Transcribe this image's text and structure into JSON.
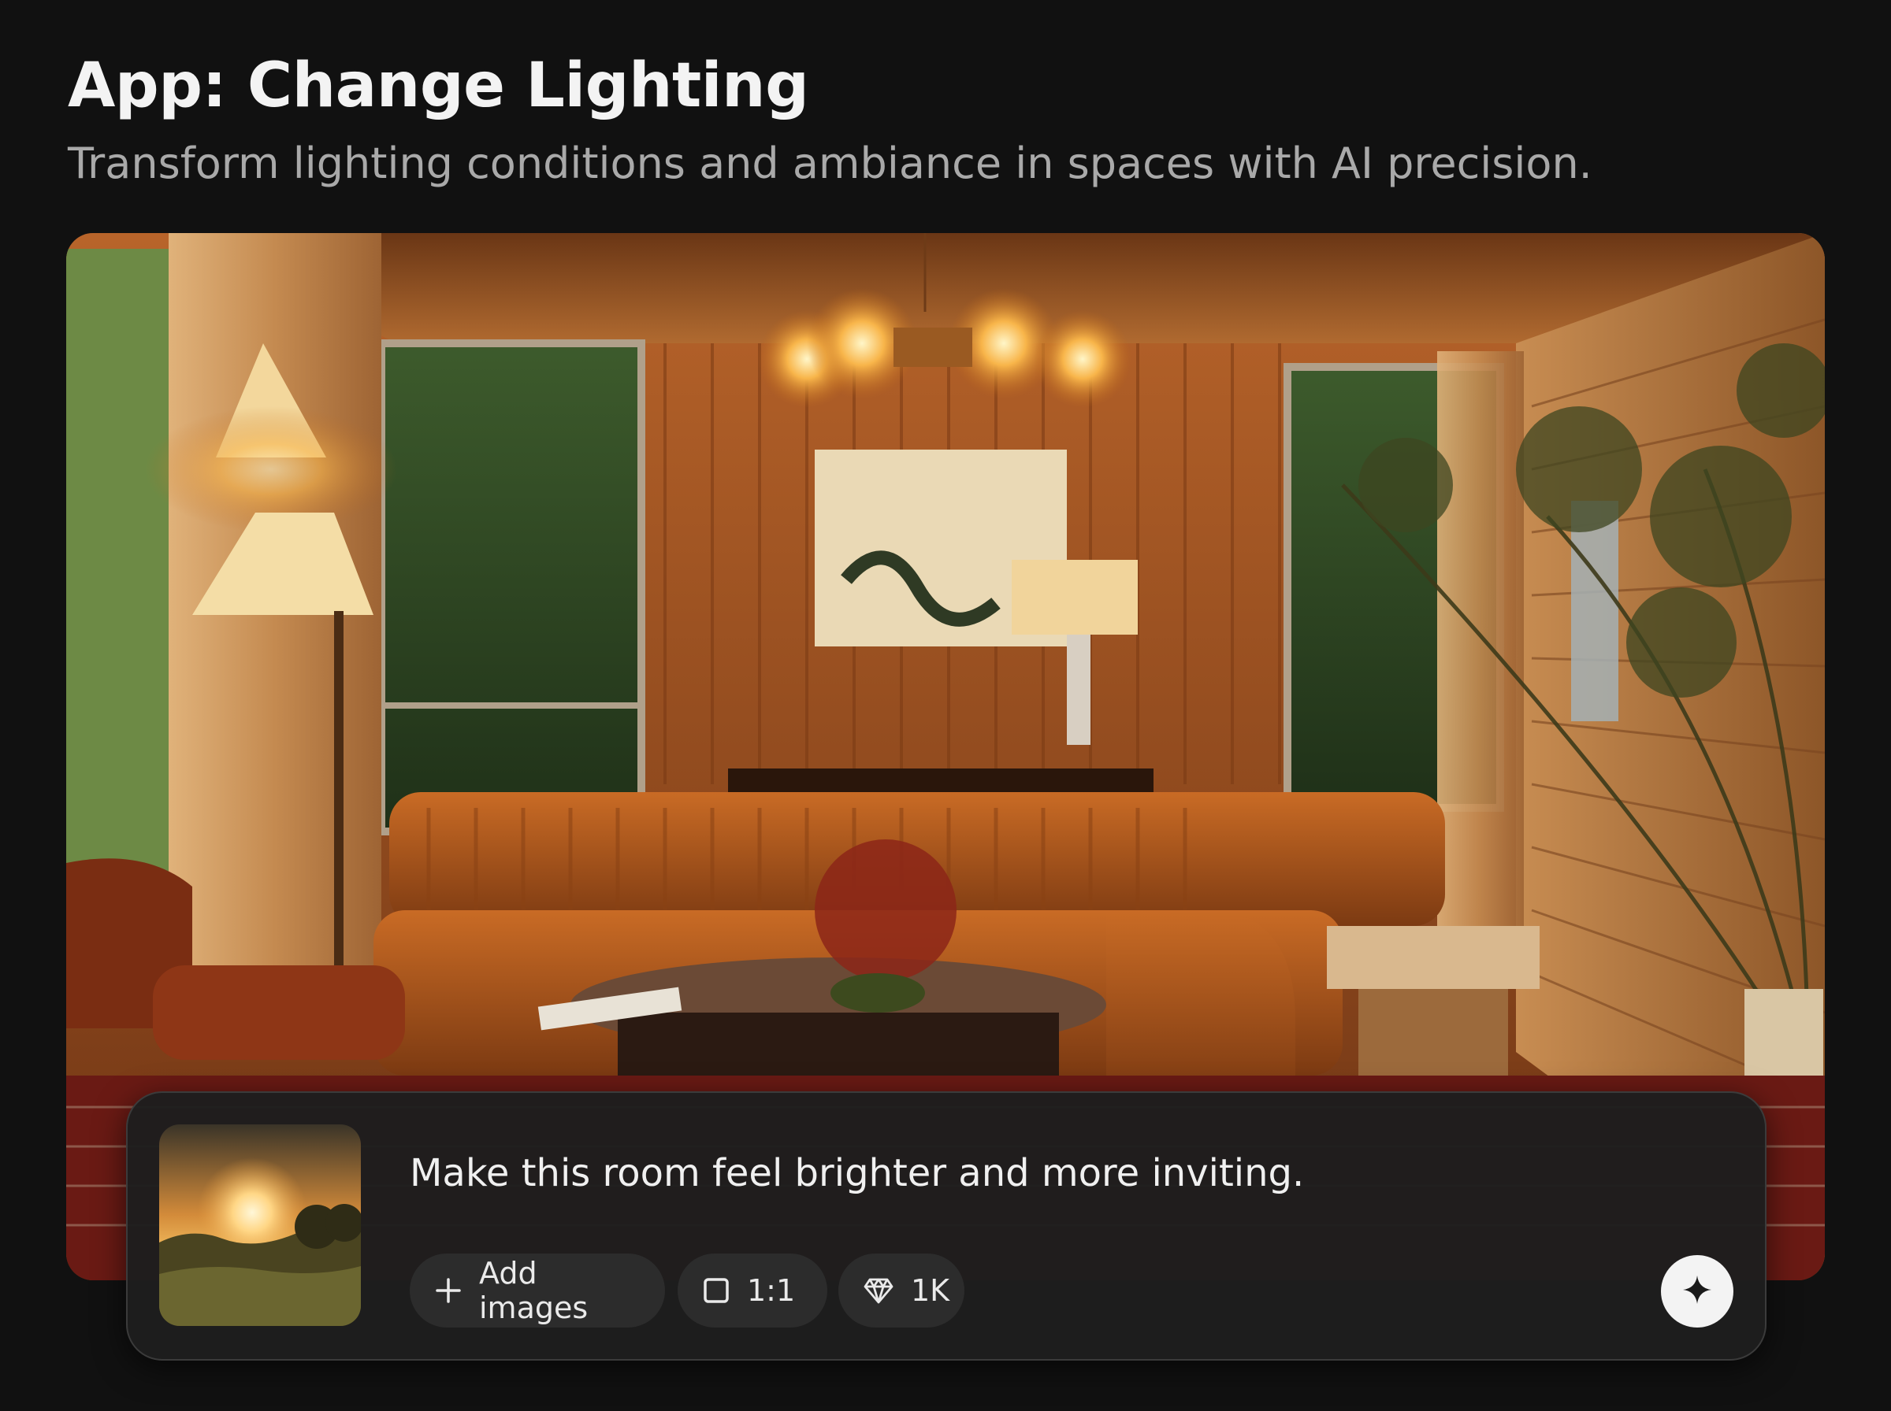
{
  "header": {
    "title": "App: Change Lighting",
    "subtitle": "Transform lighting conditions and ambiance in spaces with AI precision."
  },
  "hero_image": {
    "icon": "living-room-photo"
  },
  "prompt_panel": {
    "reference_image_icon": "sunset-field-photo",
    "prompt_text": "Make this room feel brighter and more inviting.",
    "chips": {
      "add_images": "Add images",
      "aspect_ratio": "1:1",
      "resolution": "1K"
    },
    "send_icon": "sparkle-icon"
  },
  "colors": {
    "background": "#111111",
    "panel": "#1e1e1e",
    "chip": "#2c2c2c",
    "text_primary": "#f3f3f3",
    "text_secondary": "#a9a9a9",
    "send_button": "#f3f3f3"
  }
}
